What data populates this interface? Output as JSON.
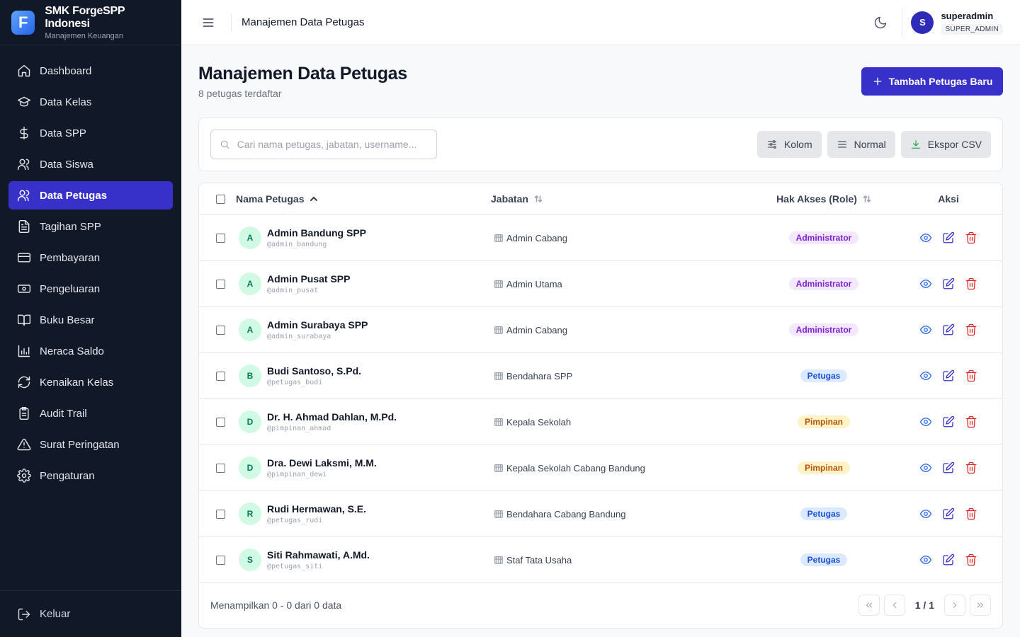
{
  "brand": {
    "name": "SMK ForgeSPP Indonesi",
    "subtitle": "Manajemen Keuangan",
    "logo_letter": "F"
  },
  "sidebar": {
    "items": [
      {
        "label": "Dashboard",
        "icon": "home-icon"
      },
      {
        "label": "Data Kelas",
        "icon": "graduation-cap-icon"
      },
      {
        "label": "Data SPP",
        "icon": "dollar-icon"
      },
      {
        "label": "Data Siswa",
        "icon": "users-icon"
      },
      {
        "label": "Data Petugas",
        "icon": "users-icon",
        "active": true
      },
      {
        "label": "Tagihan SPP",
        "icon": "file-text-icon"
      },
      {
        "label": "Pembayaran",
        "icon": "credit-card-icon"
      },
      {
        "label": "Pengeluaran",
        "icon": "banknote-icon"
      },
      {
        "label": "Buku Besar",
        "icon": "book-icon"
      },
      {
        "label": "Neraca Saldo",
        "icon": "bar-chart-icon"
      },
      {
        "label": "Kenaikan Kelas",
        "icon": "refresh-icon"
      },
      {
        "label": "Audit Trail",
        "icon": "clipboard-icon"
      },
      {
        "label": "Surat Peringatan",
        "icon": "warning-icon"
      },
      {
        "label": "Pengaturan",
        "icon": "gear-icon"
      }
    ],
    "logout_label": "Keluar"
  },
  "header": {
    "title": "Manajemen Data Petugas",
    "user": {
      "initial": "S",
      "name": "superadmin",
      "role": "SUPER_ADMIN"
    }
  },
  "page": {
    "title": "Manajemen Data Petugas",
    "subtitle": "8 petugas terdaftar",
    "add_button": "Tambah Petugas Baru"
  },
  "toolbar": {
    "search_placeholder": "Cari nama petugas, jabatan, username...",
    "search_value": "",
    "columns_label": "Kolom",
    "density_label": "Normal",
    "export_label": "Ekspor CSV"
  },
  "table": {
    "headers": {
      "name": "Nama Petugas",
      "job": "Jabatan",
      "role": "Hak Akses (Role)",
      "actions": "Aksi"
    },
    "rows": [
      {
        "initial": "A",
        "name": "Admin Bandung SPP",
        "username": "@admin_bandung",
        "job": "Admin Cabang",
        "role": "Administrator",
        "role_type": "admin"
      },
      {
        "initial": "A",
        "name": "Admin Pusat SPP",
        "username": "@admin_pusat",
        "job": "Admin Utama",
        "role": "Administrator",
        "role_type": "admin"
      },
      {
        "initial": "A",
        "name": "Admin Surabaya SPP",
        "username": "@admin_surabaya",
        "job": "Admin Cabang",
        "role": "Administrator",
        "role_type": "admin"
      },
      {
        "initial": "B",
        "name": "Budi Santoso, S.Pd.",
        "username": "@petugas_budi",
        "job": "Bendahara SPP",
        "role": "Petugas",
        "role_type": "petugas"
      },
      {
        "initial": "D",
        "name": "Dr. H. Ahmad Dahlan, M.Pd.",
        "username": "@pimpinan_ahmad",
        "job": "Kepala Sekolah",
        "role": "Pimpinan",
        "role_type": "pimpinan"
      },
      {
        "initial": "D",
        "name": "Dra. Dewi Laksmi, M.M.",
        "username": "@pimpinan_dewi",
        "job": "Kepala Sekolah Cabang Bandung",
        "role": "Pimpinan",
        "role_type": "pimpinan"
      },
      {
        "initial": "R",
        "name": "Rudi Hermawan, S.E.",
        "username": "@petugas_rudi",
        "job": "Bendahara Cabang Bandung",
        "role": "Petugas",
        "role_type": "petugas"
      },
      {
        "initial": "S",
        "name": "Siti Rahmawati, A.Md.",
        "username": "@petugas_siti",
        "job": "Staf Tata Usaha",
        "role": "Petugas",
        "role_type": "petugas"
      }
    ]
  },
  "footer": {
    "summary": "Menampilkan 0 - 0 dari 0 data",
    "page_indicator": "1 / 1"
  }
}
